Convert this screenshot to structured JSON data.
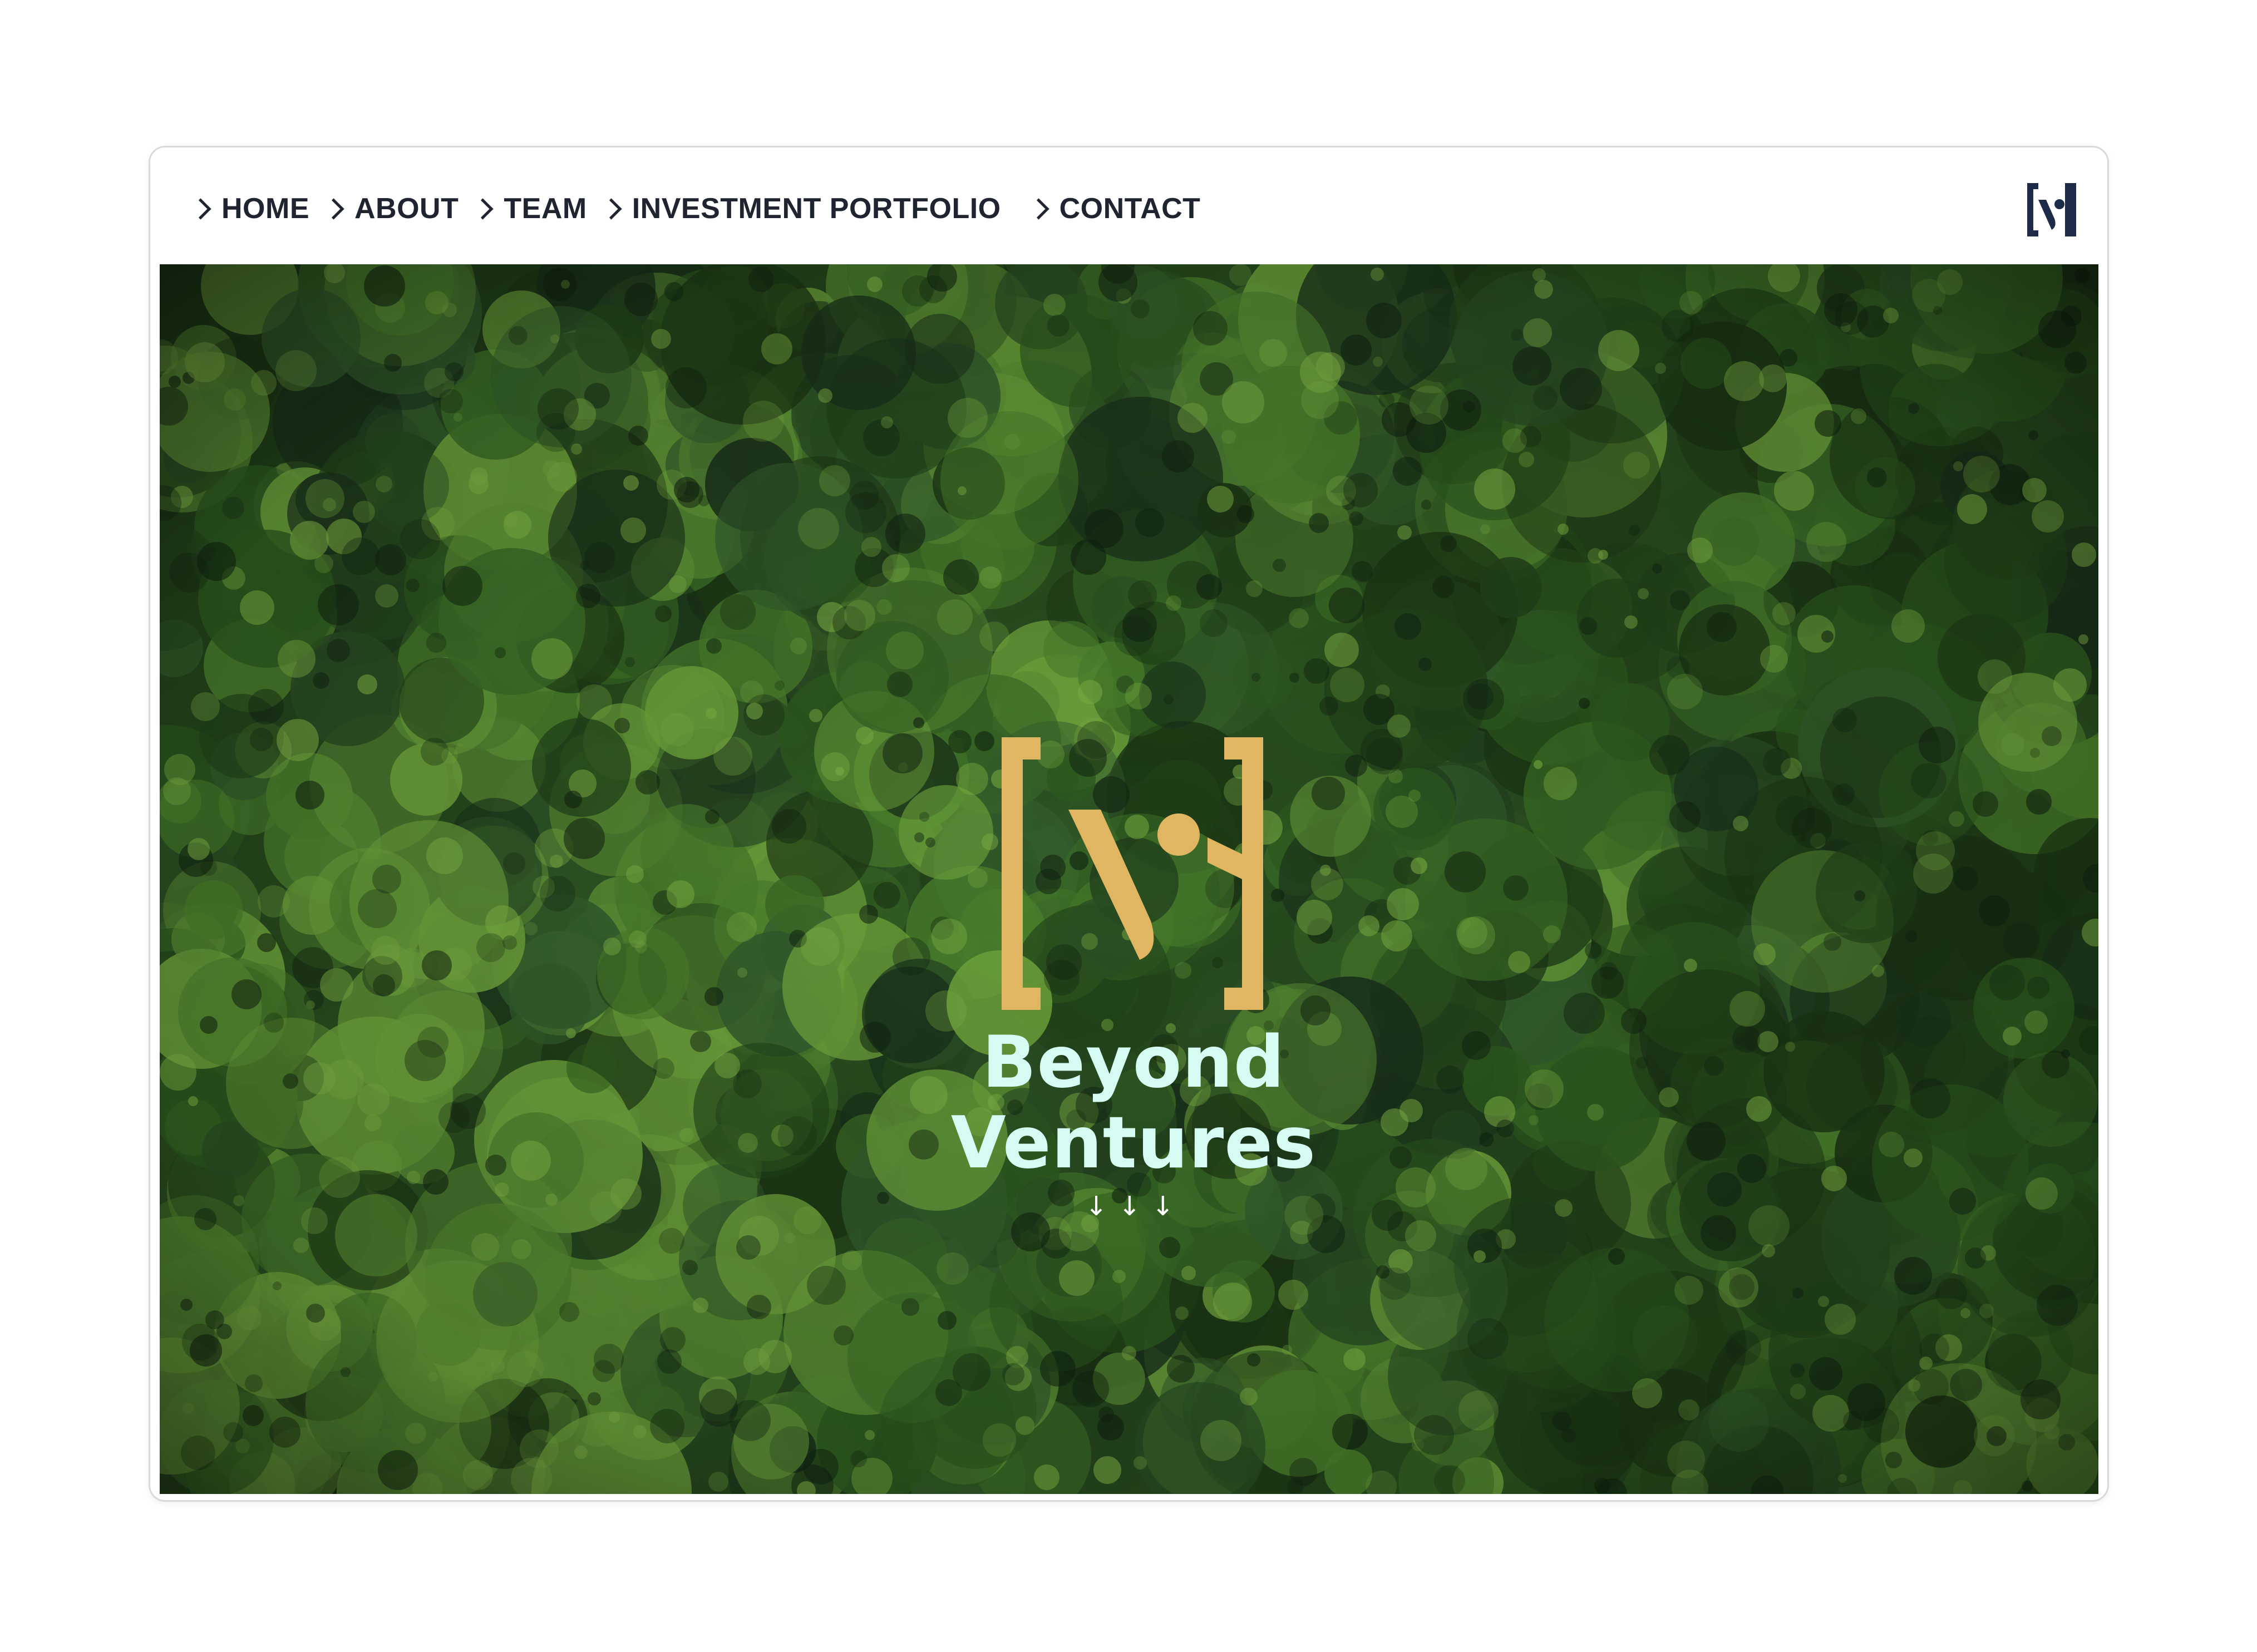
{
  "nav": {
    "items": [
      {
        "label": "HOME"
      },
      {
        "label": "ABOUT"
      },
      {
        "label": "TEAM"
      },
      {
        "label": "INVESTMENT PORTFOLIO"
      },
      {
        "label": "CONTACT"
      }
    ]
  },
  "hero": {
    "brand_line1": "Beyond",
    "brand_line2": "Ventures",
    "scroll_arrows": [
      "↓",
      "↓",
      "↓"
    ]
  },
  "colors": {
    "nav_text": "#1f2430",
    "logo_navy": "#1e2a4a",
    "logo_gold": "#e0b663",
    "brand_text": "#d6fbf3",
    "forest": "#2d5a1c"
  },
  "icons": {
    "chevron": "chevron-right-icon",
    "corner_logo": "beyond-ventures-logo-icon",
    "scroll": "arrow-down-icon"
  }
}
